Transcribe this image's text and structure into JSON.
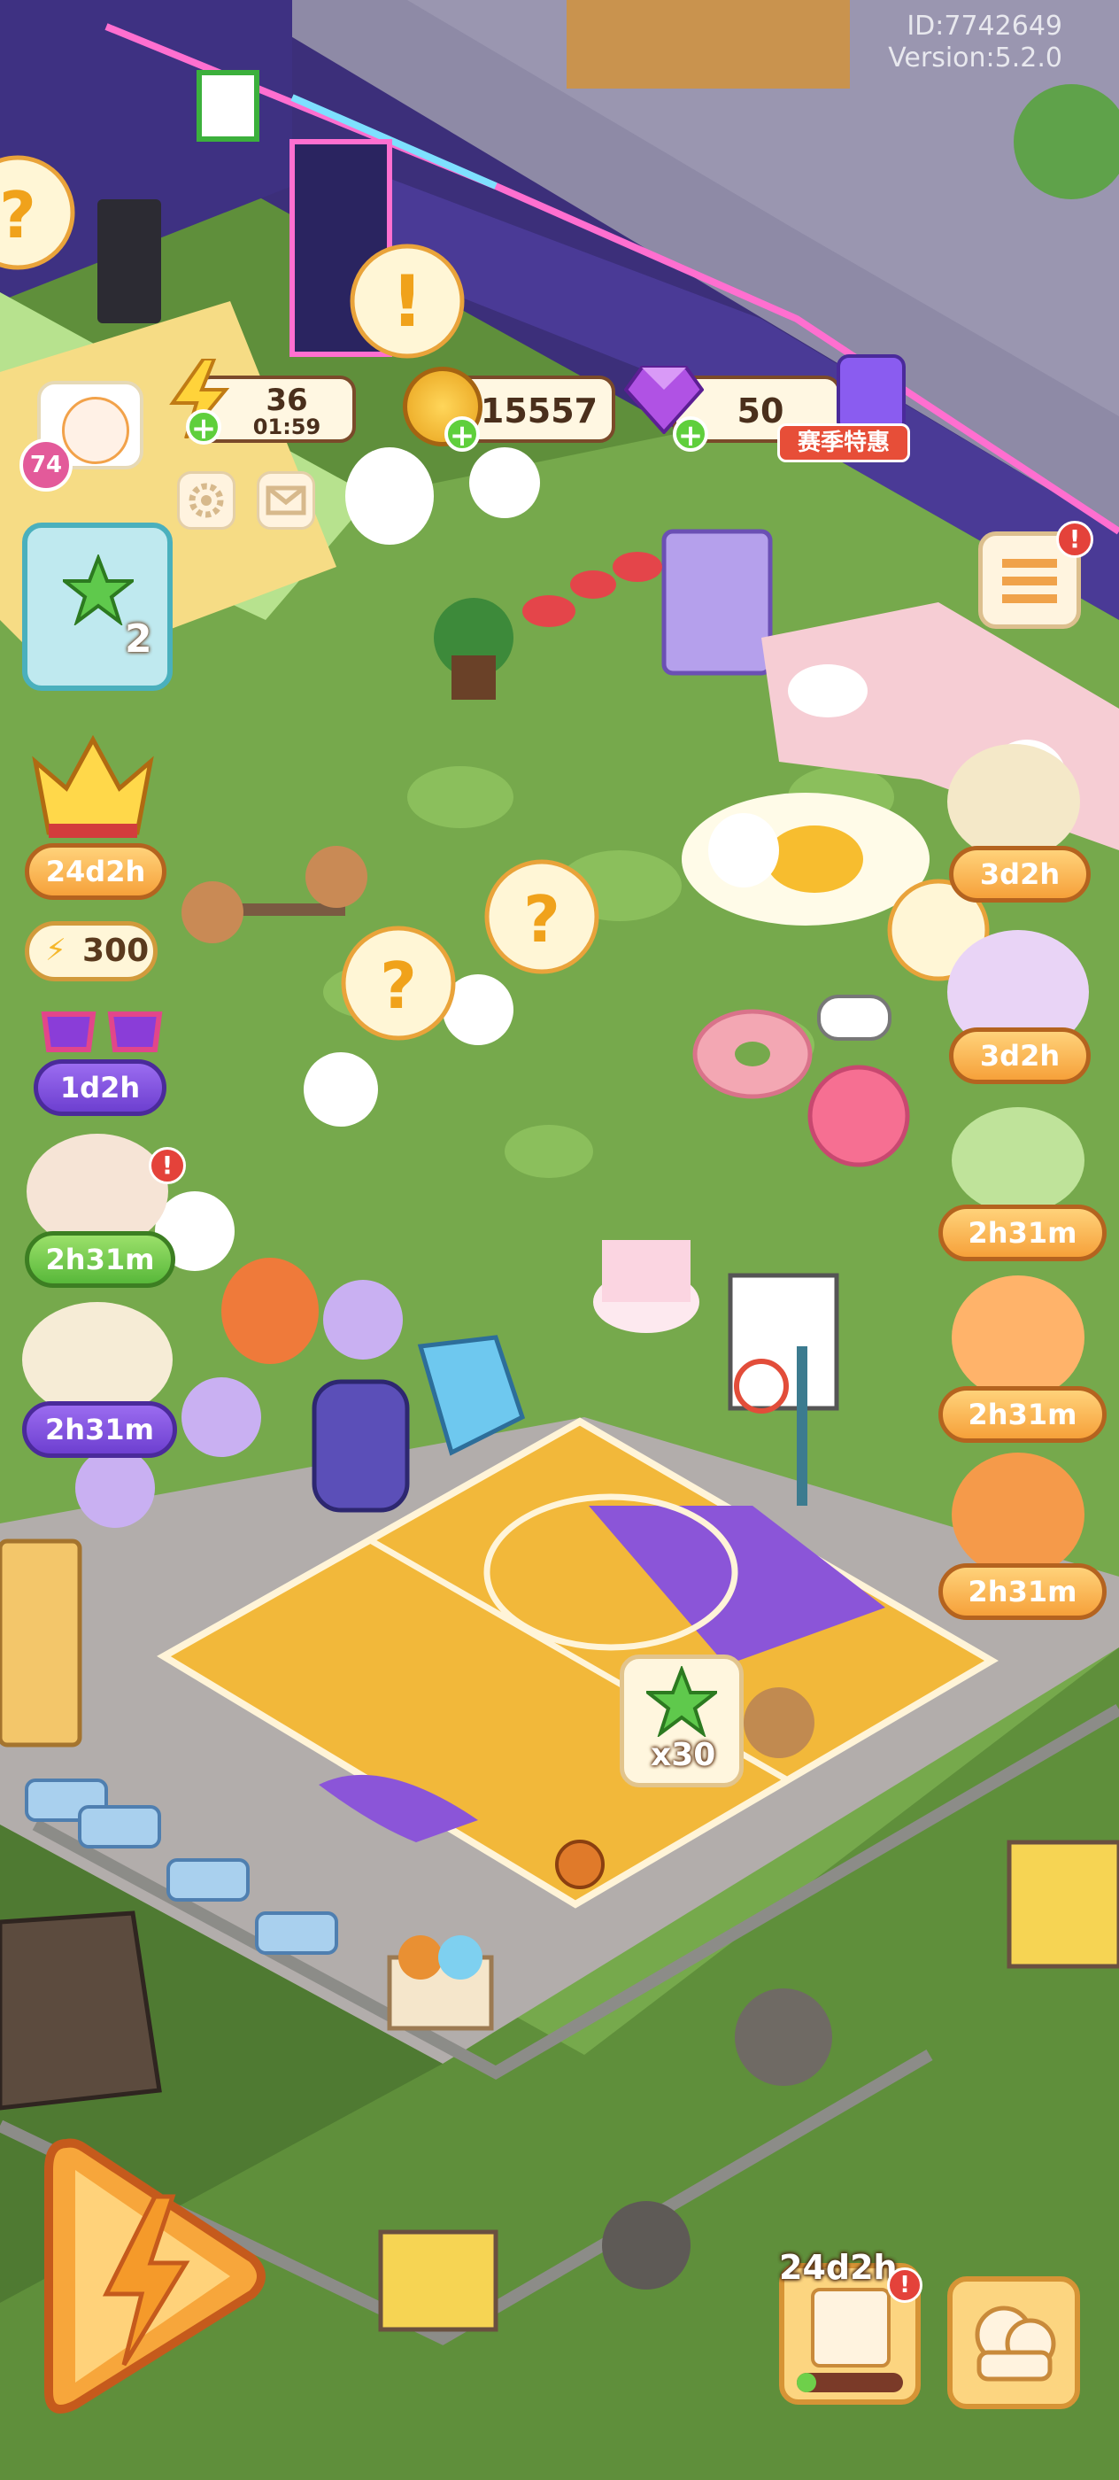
{
  "header": {
    "id_text": "ID:7742649",
    "version_text": "Version:5.2.0"
  },
  "resources": {
    "energy": {
      "value": "36",
      "timer": "01:59",
      "icon": "lightning-icon"
    },
    "coins": {
      "value": "15557",
      "icon": "coin-icon"
    },
    "gems": {
      "value": "50",
      "icon": "gem-icon"
    },
    "event_label": "赛季特惠"
  },
  "player": {
    "level": "74"
  },
  "task_board": {
    "count": "2"
  },
  "left_events": [
    {
      "name": "crown-event",
      "timer": "24d2h"
    },
    {
      "name": "energy-reward",
      "reward": "300"
    },
    {
      "name": "glasses-event",
      "timer": "1d2h"
    },
    {
      "name": "bird-gift-event",
      "timer": "2h31m"
    },
    {
      "name": "card-event",
      "timer": "2h31m"
    }
  ],
  "right_events": [
    {
      "name": "study-duck-event",
      "timer": "3d2h"
    },
    {
      "name": "princess-event",
      "timer": "3d2h"
    },
    {
      "name": "garden-event",
      "timer": "2h31m"
    },
    {
      "name": "fire-event",
      "timer": "2h31m"
    },
    {
      "name": "explosion-event",
      "timer": "2h31m"
    }
  ],
  "court_reward": {
    "label": "x30"
  },
  "bottom": {
    "album_timer": "24d2h"
  },
  "colors": {
    "wall": "#4a3c8c",
    "grass": "#6ea94a",
    "court_yellow": "#f2b83a",
    "court_purple": "#8b55d8",
    "road": "#a8a3a3"
  }
}
